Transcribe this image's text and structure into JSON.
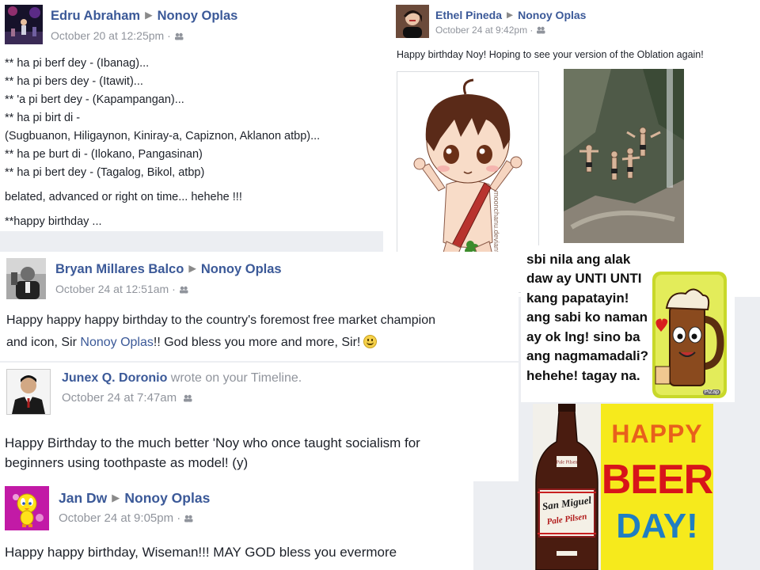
{
  "posts": {
    "edru": {
      "author": "Edru Abraham",
      "target": "Nonoy Oplas",
      "time": "October 20 at 12:25pm ·",
      "lines": [
        "** ha pi berf dey - (Ibanag)...",
        "** ha pi bers dey - (Itawit)...",
        "** 'a pi bert dey - (Kapampangan)...",
        "** ha pi birt di -",
        "(Sugbuanon, Hiligaynon, Kiniray-a, Capiznon, Aklanon atbp)...",
        "** ha pe burt di - (Ilokano, Pangasinan)",
        "** ha pi bert dey - (Tagalog, Bikol, atbp)",
        "belated, advanced or right on time... hehehe !!!",
        "**happy birthday ..."
      ]
    },
    "ethel": {
      "author": "Ethel Pineda",
      "target": "Nonoy Oplas",
      "time": "October 24 at 9:42pm ·",
      "text": "Happy birthday Noy! Hoping to see your version of the Oblation again!",
      "watermark": "moonchanu.deviantart.com"
    },
    "bryan": {
      "author": "Bryan Millares Balco",
      "target": "Nonoy Oplas",
      "time": "October 24 at 12:51am ·",
      "line1": "Happy happy happy birthday to the country's foremost free market champion",
      "line2_a": "and icon, Sir ",
      "line2_link": "Nonoy Oplas",
      "line2_b": "!! God bless you more and more, Sir!"
    },
    "junex": {
      "author": "Junex Q. Doronio",
      "suffix": "wrote on your Timeline.",
      "time": "October 24 at 7:47am",
      "line1": "Happy Birthday to the much better 'Noy who once taught socialism for",
      "line2": "beginners using toothpaste as model! (y)"
    },
    "jan": {
      "author": "Jan Dw",
      "target": "Nonoy Oplas",
      "time": "October 24 at 9:05pm ·",
      "text": "Happy happy birthday, Wiseman!!! MAY GOD bless you evermore"
    }
  },
  "meme": {
    "lines": [
      "sbi nila ang alak",
      "daw ay UNTI UNTI",
      "kang papatayin!",
      "ang sabi ko naman",
      "ay ok lng! sino ba",
      "ang nagmamadali?",
      "hehehe! tagay na."
    ],
    "sticker_sig": "PiZap"
  },
  "beer_day": {
    "word1": "HAPPY",
    "word2": "BEER",
    "word3": "DAY!",
    "label_brand": "San Miguel",
    "label_type": "Pale Pilsen",
    "colors": {
      "bg": "#f6ea1c",
      "happy": "#e8601c",
      "beer": "#d7141a",
      "day": "#1f7ec2"
    }
  },
  "colors": {
    "link": "#3b5998",
    "muted": "#90949c",
    "text": "#1d2129"
  }
}
